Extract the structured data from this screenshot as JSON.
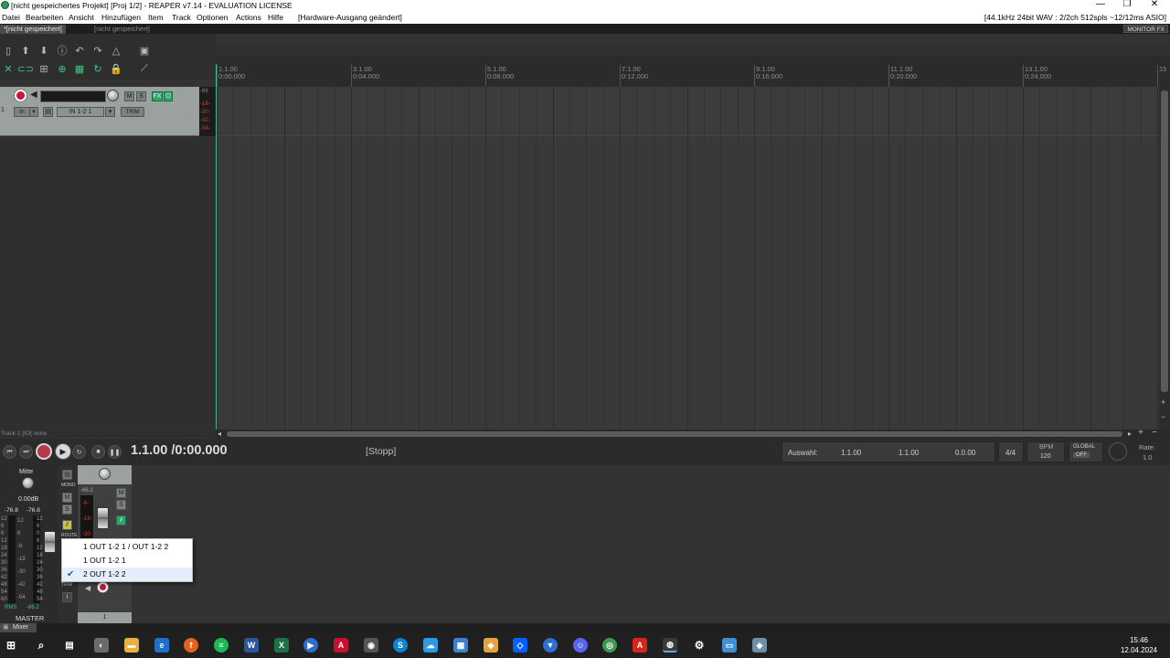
{
  "window": {
    "title": "[nicht gespeichertes Projekt] [Proj 1/2] - REAPER v7.14 - EVALUATION LICENSE",
    "minimize": "—",
    "maximize": "❐",
    "close": "✕"
  },
  "menu": {
    "items": [
      "Datei",
      "Bearbeiten",
      "Ansicht",
      "Hinzufügen",
      "Item",
      "Track",
      "Optionen",
      "Actions",
      "Hilfe"
    ],
    "notice": "[Hardware-Ausgang geändert]",
    "audio_status": "[44.1kHz 24bit WAV : 2/2ch 512spls ~12/12ms ASIO]"
  },
  "tabs": {
    "active": "*[nicht gespeichert]",
    "inactive": "[nicht gespeichert]",
    "monitor_fx": "MONITOR FX"
  },
  "ruler": {
    "marks": [
      {
        "bar": "1.1.00",
        "time": "0:00.000"
      },
      {
        "bar": "3.1.00",
        "time": "0:04.000"
      },
      {
        "bar": "5.1.00",
        "time": "0:08.000"
      },
      {
        "bar": "7.1.00",
        "time": "0:12.000"
      },
      {
        "bar": "9.1.00",
        "time": "0:16.000"
      },
      {
        "bar": "11.1.00",
        "time": "0:20.000"
      },
      {
        "bar": "13.1.00",
        "time": "0:24.000"
      },
      {
        "bar": "15",
        "time": ""
      }
    ]
  },
  "track": {
    "number": "1",
    "input_mode": "in",
    "input": "IN 1-2 1",
    "mute": "M",
    "solo": "S",
    "fx": "FX",
    "trim": "TRIM",
    "meter_labels": [
      "-66",
      "-18-",
      "-30-",
      "-42-",
      "-54-"
    ],
    "info": "Track 1 [IO] none"
  },
  "transport": {
    "position": "1.1.00 /0:00.000",
    "state": "[Stopp]",
    "selection_label": "Auswahl:",
    "sel_start": "1.1.00",
    "sel_end": "1.1.00",
    "sel_length": "0.0.00",
    "time_signature": "4/4",
    "bpm_label": "BPM",
    "bpm": "120",
    "global_label": "GLOBAL",
    "global_state": "OFF",
    "rate_label": "Rate:",
    "rate": "1.0"
  },
  "mixer": {
    "master_pan": "Mitte",
    "master_volume": "0.00dB",
    "master_peak_l": "-76.8",
    "master_peak_r": "-76.8",
    "master_name": "MASTER",
    "rms_label": "RMS",
    "rms_value": "-86.2",
    "mono": "MONO",
    "mute": "M",
    "solo": "S",
    "route": "ROUTE",
    "trim": "TRIM",
    "info": "i",
    "strip_peak": "-66.2",
    "strip_number": "1",
    "tab_label": "Mixer",
    "scale_left": [
      "12",
      "6",
      "6",
      "12",
      "18",
      "24",
      "30",
      "36",
      "42",
      "48",
      "54",
      "60"
    ],
    "scale_mid": [
      "12",
      "6",
      "-6",
      "-18",
      "-30",
      "-42",
      "-54"
    ],
    "scale_right": [
      "12",
      "6",
      "0",
      "6",
      "12",
      "18",
      "24",
      "30",
      "36",
      "42",
      "48",
      "54"
    ],
    "strip_meter_labels": [
      "-6-",
      "-18-",
      "-30-"
    ]
  },
  "dropdown": {
    "items": [
      {
        "label": "1 OUT 1-2 1 / OUT 1-2 2",
        "checked": false
      },
      {
        "label": "1 OUT 1-2 1",
        "checked": false
      },
      {
        "label": "2 OUT 1-2 2",
        "checked": true
      }
    ]
  },
  "taskbar": {
    "time": "15:46",
    "date": "12.04.2024"
  },
  "colors": {
    "accent_green": "#3ec77a",
    "record_red": "#c8173a",
    "track_header": "#9aa19f",
    "arrange_bg": "#393939"
  }
}
